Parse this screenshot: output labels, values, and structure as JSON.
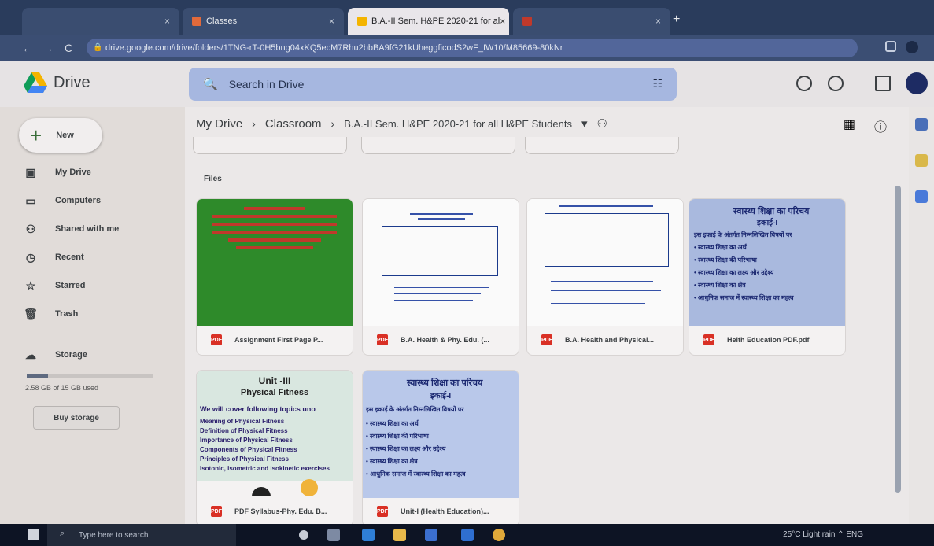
{
  "browser": {
    "tabs": [
      {
        "label": "",
        "active": false
      },
      {
        "label": "Classes",
        "active": false
      },
      {
        "label": "B.A.-II Sem. H&PE 2020-21 for al",
        "active": true
      },
      {
        "label": "",
        "active": false
      }
    ],
    "new_tab": "+",
    "url": "drive.google.com/drive/folders/1TNG-rT-0H5bng04xKQ5ecM7Rhu2bbBA9fG21kUheggficodS2wF_IW10/M85669-80kNr",
    "nav": {
      "back": "←",
      "forward": "→",
      "reload": "C"
    }
  },
  "drive": {
    "app_name": "Drive",
    "search_placeholder": "Search in Drive",
    "new_label": "New",
    "sidebar": [
      {
        "label": "My Drive",
        "icon": "my-drive-icon",
        "glyph": "▣"
      },
      {
        "label": "Computers",
        "icon": "computer-icon",
        "glyph": "▭"
      },
      {
        "label": "Shared with me",
        "icon": "people-icon",
        "glyph": "⚇"
      },
      {
        "label": "Recent",
        "icon": "clock-icon",
        "glyph": "◷"
      },
      {
        "label": "Starred",
        "icon": "star-icon",
        "glyph": "☆"
      },
      {
        "label": "Trash",
        "icon": "trash-icon",
        "glyph": "🗑"
      }
    ],
    "storage": {
      "label": "Storage",
      "used_text": "2.58 GB of 15 GB used",
      "used_fraction": 0.17
    },
    "buy_storage": "Buy storage"
  },
  "breadcrumb": {
    "root": "My Drive",
    "middle": "Classroom",
    "current": "B.A.-II Sem. H&PE 2020-21 for all H&PE Students",
    "sep": "›",
    "dropdown": "▾"
  },
  "files_label": "Files",
  "files": [
    {
      "name": "Assignment First Page P...",
      "type": "PDF",
      "thumb": "green"
    },
    {
      "name": "B.A. Health & Phy. Edu. (...",
      "type": "PDF",
      "thumb": "doc"
    },
    {
      "name": "B.A. Health and Physical...",
      "type": "PDF",
      "thumb": "doc2"
    },
    {
      "name": "Helth Education PDF.pdf",
      "type": "PDF",
      "thumb": "hindi"
    },
    {
      "name": "PDF Syllabus-Phy. Edu. B...",
      "type": "PDF",
      "thumb": "unit"
    },
    {
      "name": "Unit-I (Health Education)...",
      "type": "PDF",
      "thumb": "hindi2"
    }
  ],
  "thumb_text": {
    "hindi_title": "स्वास्थ्य शिक्षा का परिचय",
    "hindi_sub": "इकाई-I",
    "hindi_lines": [
      "इस इकाई के अंतर्गत निम्नलिखित विषयों पर",
      "• स्वास्थ्य शिक्षा का अर्थ",
      "• स्वास्थ्य शिक्षा की परिभाषा",
      "• स्वास्थ्य शिक्षा का लक्ष्य और उद्देश्य",
      "• स्वास्थ्य शिक्षा का क्षेत्र",
      "• आधुनिक समाज में स्वास्थ्य शिक्षा का महत्व"
    ],
    "unit_title": "Unit -III",
    "unit_sub": "Physical Fitness",
    "unit_lines": [
      "We will cover following topics uno",
      "Meaning of Physical Fitness",
      "Definition of Physical Fitness",
      "Importance of Physical Fitness",
      "Components of Physical Fitness",
      "Principles of Physical Fitness",
      "Isotonic, isometric and isokinetic exercises"
    ]
  },
  "taskbar": {
    "search_placeholder": "Type here to search",
    "tray_text": "25°C  Light rain  ⌃  ENG"
  },
  "colors": {
    "accent": "#1a73e8",
    "pdf": "#d93025",
    "green_thumb": "#2e8a2a"
  }
}
